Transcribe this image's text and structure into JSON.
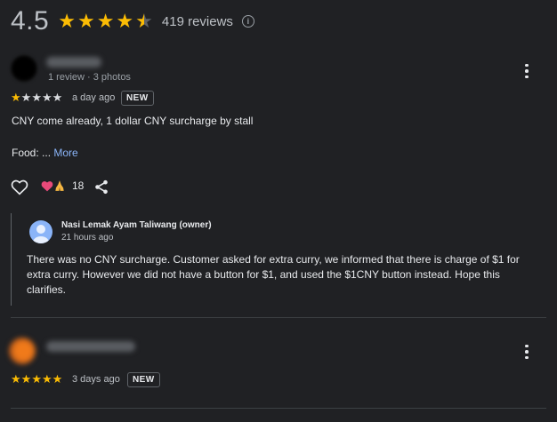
{
  "summary": {
    "rating": "4.5",
    "rating_value": 4.5,
    "review_count": "419 reviews",
    "info_symbol": "i"
  },
  "reviews": [
    {
      "reviewer_meta": "1 review · 3 photos",
      "stars": 1,
      "time": "a day ago",
      "badge": "NEW",
      "text": "CNY come already, 1 dollar CNY surcharge by stall",
      "food_label": "Food: ...",
      "more_link": "More",
      "reaction_count": "18",
      "owner_response": {
        "name": "Nasi Lemak Ayam Taliwang (owner)",
        "time": "21 hours ago",
        "text": "There was no CNY surcharge. Customer asked for extra curry, we informed that there is charge of $1 for extra curry. However we did not have a button for $1, and used the $1CNY button instead. Hope this clarifies."
      }
    },
    {
      "stars": 5,
      "time": "3 days ago",
      "badge": "NEW"
    }
  ],
  "colors": {
    "background": "#202124",
    "star": "#fbbc04",
    "link": "#8ab4f8",
    "text": "#e8eaed"
  }
}
